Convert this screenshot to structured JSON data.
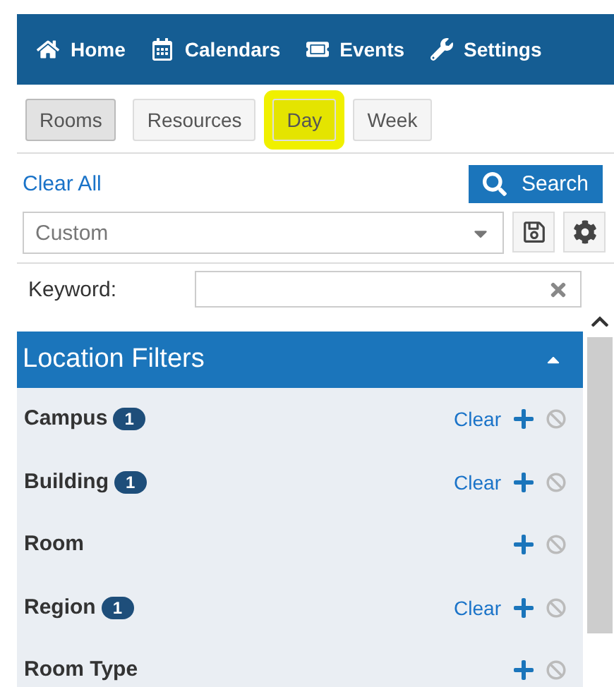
{
  "nav": [
    {
      "label": "Home"
    },
    {
      "label": "Calendars"
    },
    {
      "label": "Events"
    },
    {
      "label": "Settings"
    }
  ],
  "tabs": [
    {
      "label": "Rooms",
      "selected": true,
      "highlighted": false
    },
    {
      "label": "Resources",
      "selected": false,
      "highlighted": false
    },
    {
      "label": "Day",
      "selected": false,
      "highlighted": true
    },
    {
      "label": "Week",
      "selected": false,
      "highlighted": false
    }
  ],
  "clear_all": "Clear All",
  "search_button": "Search",
  "saved_search": {
    "value": "Custom"
  },
  "keyword": {
    "label": "Keyword:"
  },
  "panel": {
    "title": "Location Filters",
    "expanded": true,
    "filters": [
      {
        "name": "Campus",
        "count": "1",
        "clear": "Clear"
      },
      {
        "name": "Building",
        "count": "1",
        "clear": "Clear"
      },
      {
        "name": "Room"
      },
      {
        "name": "Region",
        "count": "1",
        "clear": "Clear"
      },
      {
        "name": "Room Type"
      }
    ]
  }
}
